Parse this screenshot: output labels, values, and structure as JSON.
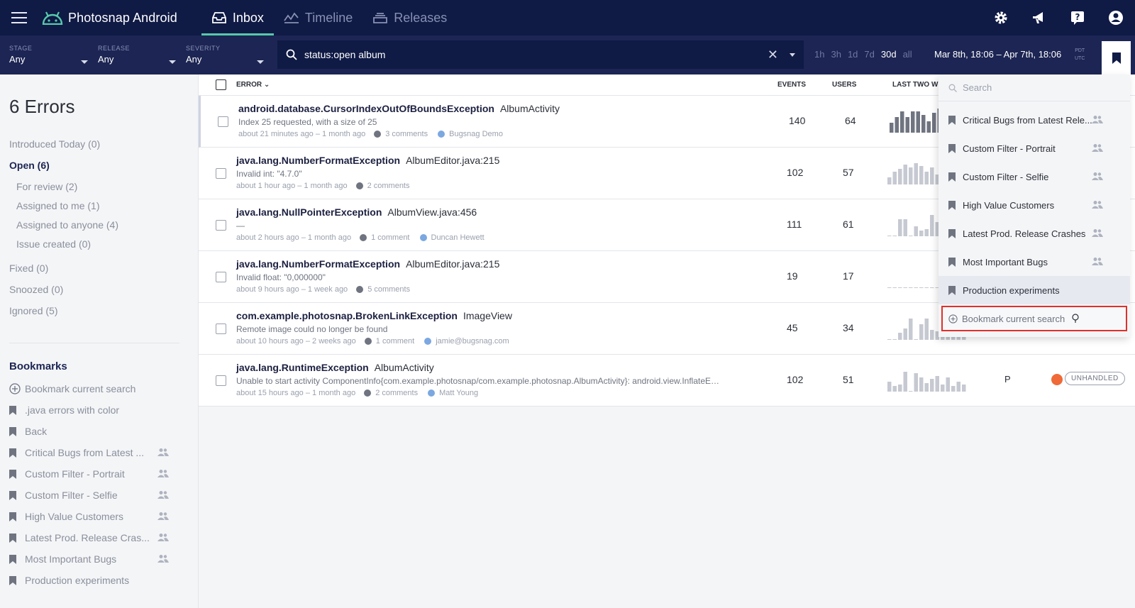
{
  "app": {
    "title": "Photosnap Android"
  },
  "nav": {
    "tabs": [
      {
        "label": "Inbox"
      },
      {
        "label": "Timeline"
      },
      {
        "label": "Releases"
      }
    ]
  },
  "filters": {
    "stage": {
      "label": "STAGE",
      "value": "Any"
    },
    "release": {
      "label": "RELEASE",
      "value": "Any"
    },
    "severity": {
      "label": "SEVERITY",
      "value": "Any"
    },
    "search_value": "status:open album",
    "ranges": [
      "1h",
      "3h",
      "1d",
      "7d",
      "30d",
      "all"
    ],
    "active_range": "30d",
    "date_range": "Mar 8th, 18:06 – Apr 7th, 18:06",
    "tz_top": "PDT",
    "tz_bottom": "UTC"
  },
  "sidebar": {
    "title": "6 Errors",
    "links": [
      {
        "label": "Introduced Today (0)"
      },
      {
        "label": "Open (6)"
      },
      {
        "label": "For review (2)"
      },
      {
        "label": "Assigned to me (1)"
      },
      {
        "label": "Assigned to anyone (4)"
      },
      {
        "label": "Issue created (0)"
      },
      {
        "label": "Fixed (0)"
      },
      {
        "label": "Snoozed (0)"
      },
      {
        "label": "Ignored (5)"
      }
    ],
    "bookmarks_title": "Bookmarks",
    "bookmark_add": "Bookmark current search",
    "bookmarks": [
      {
        "label": ".java errors with color",
        "shared": false
      },
      {
        "label": "Back",
        "shared": false
      },
      {
        "label": "Critical Bugs from Latest ...",
        "shared": true
      },
      {
        "label": "Custom Filter - Portrait",
        "shared": true
      },
      {
        "label": "Custom Filter - Selfie",
        "shared": true
      },
      {
        "label": "High Value Customers",
        "shared": true
      },
      {
        "label": "Latest Prod. Release Cras...",
        "shared": true
      },
      {
        "label": "Most Important Bugs",
        "shared": true
      },
      {
        "label": "Production experiments",
        "shared": false
      }
    ]
  },
  "table": {
    "headers": {
      "error": "ERROR",
      "events": "EVENTS",
      "users": "USERS",
      "last": "LAST TWO W"
    },
    "rows": [
      {
        "cls": "android.database.CursorIndexOutOfBoundsException",
        "ctx": "AlbumActivity",
        "msg": "Index 25 requested, with a size of 25",
        "time": "about 21 minutes ago – 1 month ago",
        "comments": "3 comments",
        "user": "Bugsnag Demo",
        "events": "140",
        "users": "64",
        "spark": [
          14,
          22,
          30,
          22,
          30,
          30,
          25,
          16,
          28,
          34,
          30,
          26,
          22,
          18,
          28
        ]
      },
      {
        "cls": "java.lang.NumberFormatException",
        "ctx": "AlbumEditor.java:215",
        "msg": "Invalid int: \"4.7.0\"",
        "time": "about 1 hour ago – 1 month ago",
        "comments": "2 comments",
        "user": "",
        "events": "102",
        "users": "57",
        "spark": [
          10,
          18,
          22,
          28,
          24,
          30,
          26,
          18,
          24,
          14,
          18,
          22,
          20,
          14,
          16
        ]
      },
      {
        "cls": "java.lang.NullPointerException",
        "ctx": "AlbumView.java:456",
        "msg": "—",
        "time": "about 2 hours ago – 1 month ago",
        "comments": "1 comment",
        "user": "Duncan Hewett",
        "events": "111",
        "users": "61",
        "spark": [
          0,
          0,
          24,
          24,
          0,
          14,
          8,
          10,
          30,
          20,
          12,
          16,
          10,
          12,
          16
        ]
      },
      {
        "cls": "java.lang.NumberFormatException",
        "ctx": "AlbumEditor.java:215",
        "msg": "Invalid float: \"0,000000\"",
        "time": "about 9 hours ago – 1 week ago",
        "comments": "5 comments",
        "user": "",
        "events": "19",
        "users": "17",
        "spark": [
          0,
          0,
          0,
          0,
          0,
          0,
          0,
          0,
          0,
          0,
          0,
          0,
          0,
          8,
          22
        ]
      },
      {
        "cls": "com.example.photosnap.BrokenLinkException",
        "ctx": "ImageView",
        "msg": "Remote image could no longer be found",
        "time": "about 10 hours ago – 2 weeks ago",
        "comments": "1 comment",
        "user": "jamie@bugsnag.com",
        "events": "45",
        "users": "34",
        "spark": [
          0,
          0,
          10,
          16,
          30,
          0,
          22,
          30,
          14,
          12,
          18,
          20,
          14,
          10,
          12
        ]
      },
      {
        "cls": "java.lang.RuntimeException",
        "ctx": "AlbumActivity",
        "msg": "Unable to start activity ComponentInfo{com.example.photosnap/com.example.photosnap.AlbumActivity}: android.view.InflateE…",
        "time": "about 15 hours ago – 1 month ago",
        "comments": "2 comments",
        "user": "Matt Young",
        "events": "102",
        "users": "51",
        "spark": [
          14,
          8,
          10,
          28,
          0,
          26,
          20,
          12,
          18,
          22,
          10,
          20,
          8,
          14,
          10
        ],
        "stage": "P",
        "badge": "UNHANDLED"
      }
    ]
  },
  "dropdown": {
    "search_placeholder": "Search",
    "items": [
      {
        "label": "Critical Bugs from Latest Rele...",
        "shared": true
      },
      {
        "label": "Custom Filter - Portrait",
        "shared": true
      },
      {
        "label": "Custom Filter - Selfie",
        "shared": true
      },
      {
        "label": "High Value Customers",
        "shared": true
      },
      {
        "label": "Latest Prod. Release Crashes",
        "shared": true
      },
      {
        "label": "Most Important Bugs",
        "shared": true
      },
      {
        "label": "Production experiments",
        "shared": false
      }
    ],
    "add_label": "Bookmark current search"
  },
  "colors": {
    "nav_bg": "#0f1a45",
    "filter_bg": "#1c2553",
    "accent": "#58c9ac",
    "highlight_border": "#e0302a",
    "unhandled_dot": "#ef6a38"
  }
}
